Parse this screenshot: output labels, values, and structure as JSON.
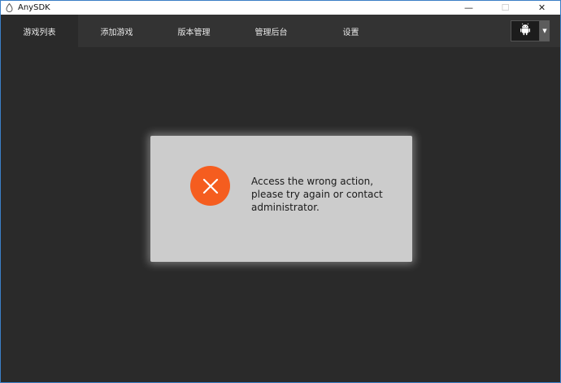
{
  "window": {
    "title": "AnySDK",
    "controls": {
      "minimize": "—",
      "maximize": "☐",
      "close": "✕"
    }
  },
  "nav": {
    "tabs": [
      {
        "label": "游戏列表",
        "active": true
      },
      {
        "label": "添加游戏",
        "active": false
      },
      {
        "label": "版本管理",
        "active": false
      },
      {
        "label": "管理后台",
        "active": false
      },
      {
        "label": "设置",
        "active": false
      }
    ],
    "platform": {
      "icon": "android-icon",
      "arrow": "▼"
    }
  },
  "dialog": {
    "icon": "error-x-icon",
    "icon_color": "#f55d1f",
    "message_lines": [
      "Access the wrong action,",
      "please try again or contact",
      "administrator."
    ]
  }
}
